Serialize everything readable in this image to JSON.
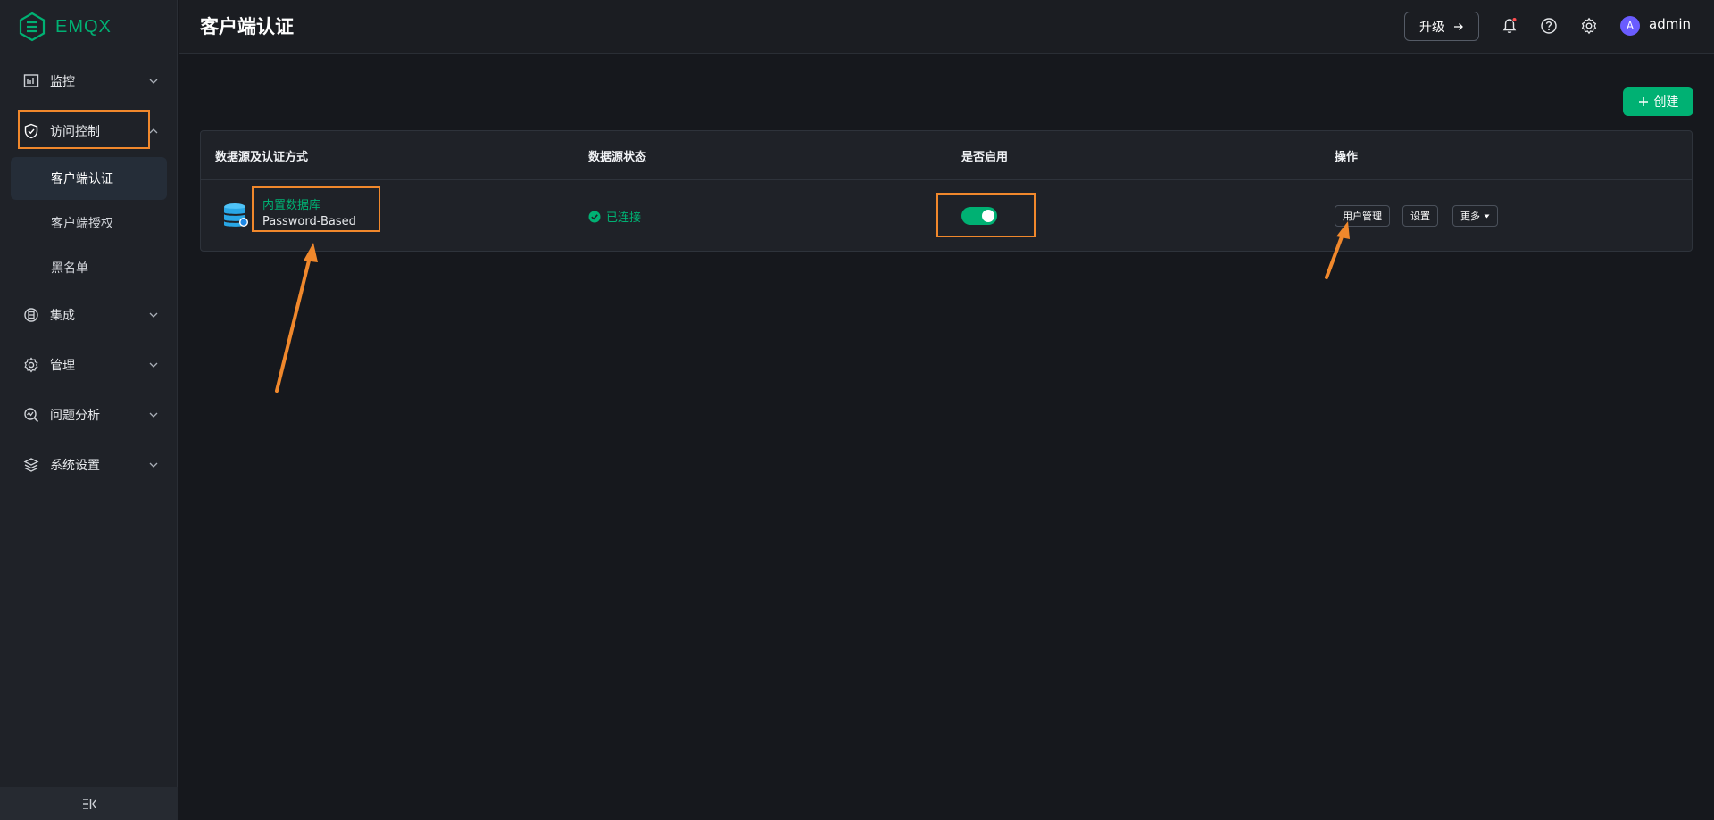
{
  "app": {
    "logo_text": "EMQX"
  },
  "sidebar": {
    "items": [
      {
        "label": "监控",
        "icon": "monitor-icon"
      },
      {
        "label": "访问控制",
        "icon": "shield-icon"
      },
      {
        "label": "集成",
        "icon": "integration-icon"
      },
      {
        "label": "管理",
        "icon": "gear-manage-icon"
      },
      {
        "label": "问题分析",
        "icon": "analysis-icon"
      },
      {
        "label": "系统设置",
        "icon": "system-icon"
      }
    ],
    "subitems": [
      {
        "label": "客户端认证",
        "active": true
      },
      {
        "label": "客户端授权",
        "active": false
      },
      {
        "label": "黑名单",
        "active": false
      }
    ],
    "collapse_icon": "collapse-sidebar-icon"
  },
  "header": {
    "title": "客户端认证",
    "upgrade_label": "升级",
    "avatar_letter": "A",
    "username": "admin"
  },
  "main": {
    "create_label": "创建",
    "table": {
      "columns": [
        "数据源及认证方式",
        "数据源状态",
        "是否启用",
        "操作"
      ],
      "rows": [
        {
          "source_name": "内置数据库",
          "auth_method": "Password-Based",
          "status": "已连接",
          "enabled": true,
          "actions": [
            "用户管理",
            "设置",
            "更多"
          ]
        }
      ]
    }
  },
  "colors": {
    "accent": "#00b173",
    "annotation": "#f0882c",
    "background": "#16181d",
    "sidebar": "#1f2228"
  }
}
